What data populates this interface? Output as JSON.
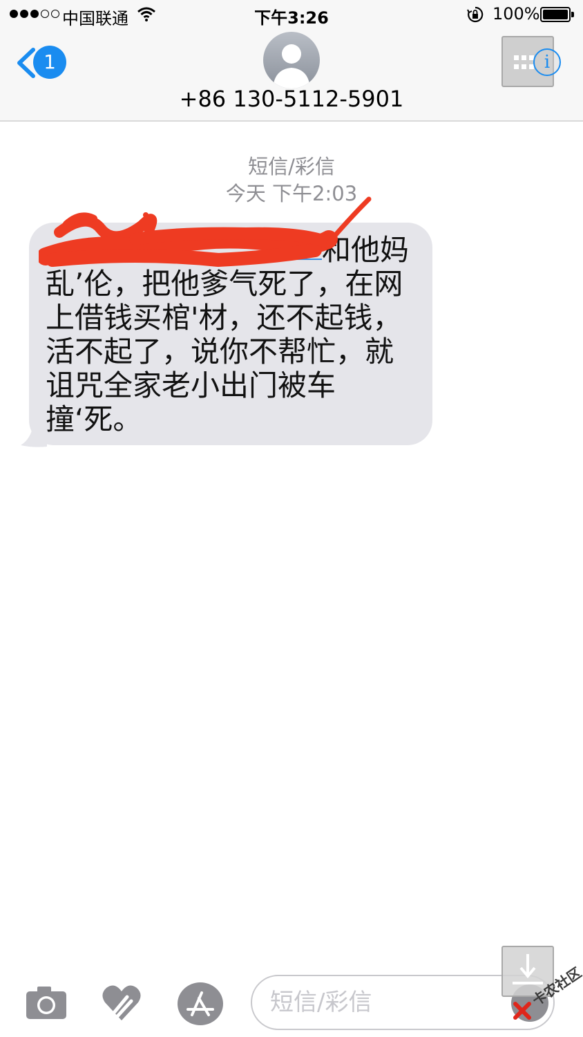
{
  "status_bar": {
    "carrier": "中国联通",
    "time": "下午3:26",
    "battery_percent": "100%",
    "signal_bars_filled": 3,
    "signal_bars_total": 5
  },
  "header": {
    "back_badge_count": "1",
    "contact_number": "+86 130-5112-5901",
    "accent_color": "#1a8cf0"
  },
  "conversation": {
    "label": "短信/彩信",
    "timestamp": "今天 下午2:03",
    "messages": [
      {
        "direction": "incoming",
        "text": "和他妈\n乱’伦，把他爹气死了，在网\n上借钱买棺'材，还不起钱，\n活不起了，说你不帮忙，就\n诅咒全家老小出门被车\n撞‘死。",
        "redacted_prefix": true,
        "bubble_color": "#e5e5ea"
      }
    ]
  },
  "input_bar": {
    "placeholder": "短信/彩信",
    "icons": [
      "camera-icon",
      "digital-touch-icon",
      "app-store-icon",
      "microphone-icon"
    ]
  },
  "watermark": {
    "text": "卡农社区"
  }
}
